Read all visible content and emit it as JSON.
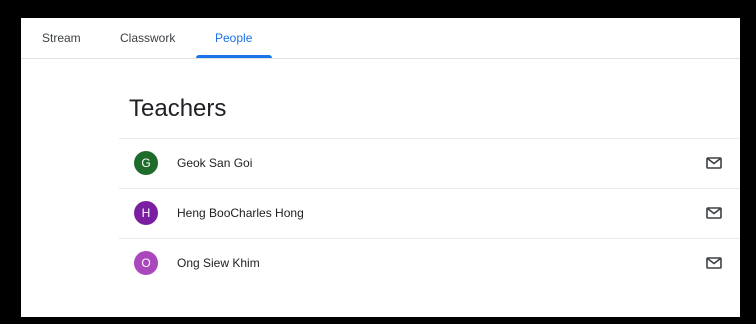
{
  "tabs": [
    {
      "label": "Stream",
      "active": false
    },
    {
      "label": "Classwork",
      "active": false
    },
    {
      "label": "People",
      "active": true
    }
  ],
  "colors": {
    "accent": "#1a73e8",
    "text": "#202124",
    "divider": "#e8eaed"
  },
  "teachers": {
    "title": "Teachers",
    "people": [
      {
        "initial": "G",
        "name": "Geok San Goi",
        "avatar_color": "#1e6b2b",
        "action_icon": "mail-icon"
      },
      {
        "initial": "H",
        "name": "Heng BooCharles Hong",
        "avatar_color": "#7b1fa2",
        "action_icon": "mail-icon"
      },
      {
        "initial": "O",
        "name": "Ong Siew Khim",
        "avatar_color": "#ab47bc",
        "action_icon": "mail-icon"
      }
    ]
  }
}
